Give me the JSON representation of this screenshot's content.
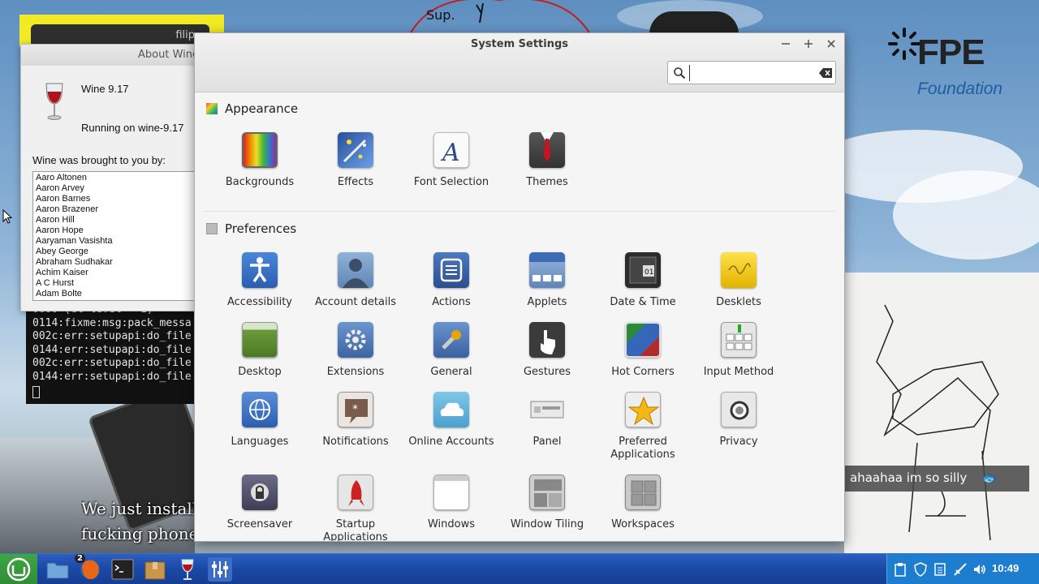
{
  "about_wine": {
    "window_title": "About Wine",
    "version": "Wine 9.17",
    "running": "Running on wine-9.17",
    "credits_title": "Wine was brought to you by:",
    "credits": [
      "Aaro Altonen",
      "Aaron Arvey",
      "Aaron Barnes",
      "Aaron Brazener",
      "Aaron Hill",
      "Aaron Hope",
      "Aaryaman Vasishta",
      "Abey George",
      "Abraham Sudhakar",
      "Achim Kaiser",
      "A C Hurst",
      "Adam Bolte"
    ]
  },
  "filip_window": {
    "title": "filip"
  },
  "terminal": {
    "lines": [
      "0000 (el level = 1)",
      "0114:fixme:msg:pack_messa",
      "002c:err:setupapi:do_file",
      "0144:err:setupapi:do_file",
      "002c:err:setupapi:do_file",
      "0144:err:setupapi:do_file"
    ]
  },
  "settings": {
    "title": "System Settings",
    "search": {
      "value": "",
      "placeholder": ""
    },
    "sections": [
      {
        "name": "Appearance",
        "items": [
          {
            "label": "Backgrounds",
            "icon": "backgrounds-icon"
          },
          {
            "label": "Effects",
            "icon": "effects-icon"
          },
          {
            "label": "Font Selection",
            "icon": "font-selection-icon"
          },
          {
            "label": "Themes",
            "icon": "themes-icon"
          }
        ]
      },
      {
        "name": "Preferences",
        "items": [
          {
            "label": "Accessibility",
            "icon": "accessibility-icon"
          },
          {
            "label": "Account details",
            "icon": "account-details-icon"
          },
          {
            "label": "Actions",
            "icon": "actions-icon"
          },
          {
            "label": "Applets",
            "icon": "applets-icon"
          },
          {
            "label": "Date & Time",
            "icon": "date-time-icon"
          },
          {
            "label": "Desklets",
            "icon": "desklets-icon"
          },
          {
            "label": "Desktop",
            "icon": "desktop-icon"
          },
          {
            "label": "Extensions",
            "icon": "extensions-icon"
          },
          {
            "label": "General",
            "icon": "general-icon"
          },
          {
            "label": "Gestures",
            "icon": "gestures-icon"
          },
          {
            "label": "Hot Corners",
            "icon": "hot-corners-icon"
          },
          {
            "label": "Input Method",
            "icon": "input-method-icon"
          },
          {
            "label": "Languages",
            "icon": "languages-icon"
          },
          {
            "label": "Notifications",
            "icon": "notifications-icon"
          },
          {
            "label": "Online Accounts",
            "icon": "online-accounts-icon"
          },
          {
            "label": "Panel",
            "icon": "panel-icon"
          },
          {
            "label": "Preferred Applications",
            "icon": "preferred-applications-icon"
          },
          {
            "label": "Privacy",
            "icon": "privacy-icon"
          },
          {
            "label": "Screensaver",
            "icon": "screensaver-icon"
          },
          {
            "label": "Startup Applications",
            "icon": "startup-applications-icon"
          },
          {
            "label": "Windows",
            "icon": "windows-icon"
          },
          {
            "label": "Window Tiling",
            "icon": "window-tiling-icon"
          },
          {
            "label": "Workspaces",
            "icon": "workspaces-icon"
          }
        ]
      }
    ]
  },
  "desktop": {
    "logo_title": "FPE",
    "logo_subtitle": "Foundation",
    "meme_label": "ahaahaa im so silly",
    "meme_caption": [
      "We just installed a",
      "fucking phone her"
    ],
    "drawing_text": "Sup."
  },
  "taskbar": {
    "firefox_badge": "2",
    "clock": "10:49"
  }
}
